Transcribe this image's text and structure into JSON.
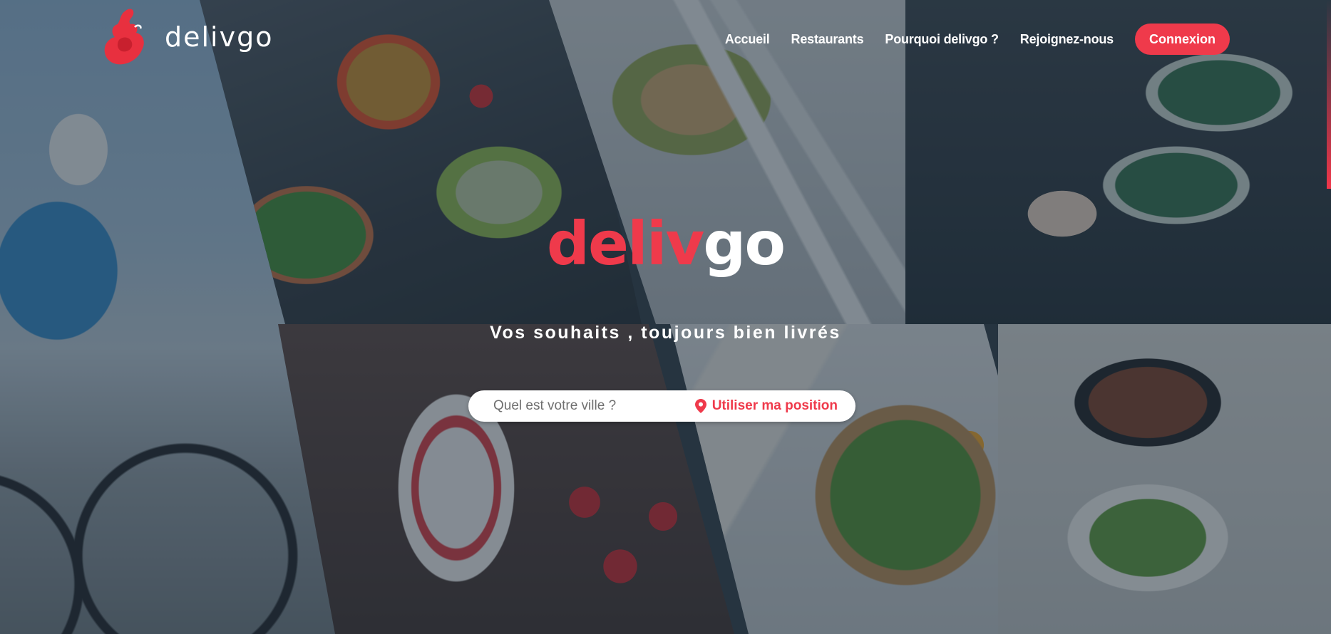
{
  "header": {
    "brand_name": "delivgo",
    "nav_items": [
      {
        "label": "Accueil"
      },
      {
        "label": "Restaurants"
      },
      {
        "label": "Pourquoi delivgo ?"
      },
      {
        "label": "Rejoignez-nous"
      }
    ],
    "login_label": "Connexion"
  },
  "hero": {
    "logo_part1": "deliv",
    "logo_part2": "go",
    "tagline": "Vos souhaits , toujours bien livrés"
  },
  "search": {
    "placeholder": "Quel est votre ville ?",
    "value": "",
    "locate_label": "Utiliser ma position",
    "locate_icon": "map-pin-icon"
  },
  "colors": {
    "accent": "#ef3a4b",
    "overlay": "#212f3d",
    "text_light": "#ffffff"
  }
}
